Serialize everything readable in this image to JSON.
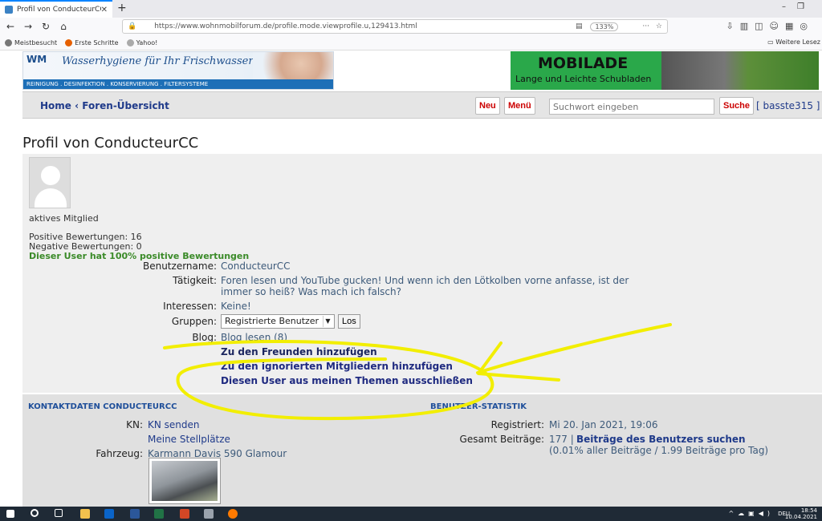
{
  "browser": {
    "tab_title": "Profil von ConducteurCC",
    "url": "https://www.wohnmobilforum.de/profile.mode.viewprofile.u,129413.html",
    "zoom": "133%",
    "bookmarks": [
      "Meistbesucht",
      "Erste Schritte",
      "Yahoo!"
    ],
    "bookmarks_right": "Weitere Lesez"
  },
  "ads": {
    "left_logo": "WM",
    "left_slogan": "Wasserhygiene für Ihr Frischwassersystem!",
    "left_strip": "REINIGUNG . DESINFEKTION . KONSERVIERUNG . FILTERSYSTEME",
    "right_brand": "MOBILADE",
    "right_sub": "Lange und Leichte Schubladen"
  },
  "nav": {
    "home": "Home",
    "sep": "‹",
    "forum": "Foren-Übersicht",
    "new_btn": "Neu",
    "menu_btn": "Menü",
    "search_placeholder": "Suchwort eingeben",
    "search_btn": "Suche",
    "user": "[ basste315 ]"
  },
  "profile": {
    "title": "Profil von ConducteurCC",
    "rank": "aktives Mitglied",
    "positive": "Positive Bewertungen: 16",
    "negative": "Negative Bewertungen: 0",
    "percent": "Dieser User hat 100% positive Bewertungen",
    "username_label": "Benutzername:",
    "username": "ConducteurCC",
    "job_label": "Tätigkeit:",
    "job_line1": "Foren lesen und YouTube gucken! Und wenn ich den Lötkolben vorne anfasse, ist der",
    "job_line2": "immer so heiß? Was mach ich falsch?",
    "interests_label": "Interessen:",
    "interests": "Keine!",
    "groups_label": "Gruppen:",
    "group_selected": "Registrierte Benutzer",
    "los": "Los",
    "blog_label": "Blog:",
    "blog_link": "Blog lesen (8)",
    "add_friend": "Zu den Freunden hinzufügen",
    "add_ignore": "Zu den ignorierten Mitgliedern hinzufügen",
    "exclude": "Diesen User aus meinen Themen ausschließen"
  },
  "contact": {
    "title": "KONTAKTDATEN CONDUCTEURCC",
    "kn_label": "KN:",
    "kn_send": "KN senden",
    "places": "Meine Stellplätze",
    "vehicle_label": "Fahrzeug:",
    "vehicle": "Karmann Davis 590 Glamour"
  },
  "stats": {
    "title": "BENUTZER-STATISTIK",
    "registered_label": "Registriert:",
    "registered": "Mi 20. Jan 2021, 19:06",
    "posts_label": "Gesamt Beiträge:",
    "posts": "177 |",
    "posts_link": "Beiträge des Benutzers suchen",
    "posts_ratio": "(0.01% aller Beiträge / 1.99 Beiträge pro Tag)"
  },
  "taskbar": {
    "lang": "DEU",
    "time": "18:54",
    "date": "10.04.2021"
  },
  "colors": {
    "link": "#1f3a8a",
    "annotation": "#f2ee00"
  }
}
